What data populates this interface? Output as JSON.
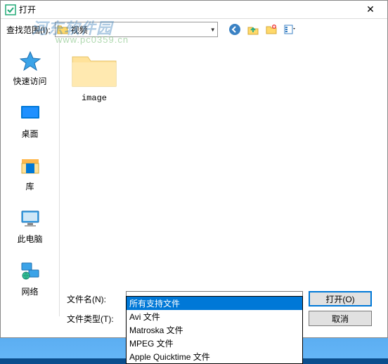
{
  "window": {
    "title": "打开"
  },
  "toolbar": {
    "lookin_label": "查找范围(I):",
    "location": "视频",
    "icons": [
      "back-icon",
      "up-icon",
      "new-folder-icon",
      "views-icon"
    ]
  },
  "sidebar": {
    "items": [
      {
        "label": "快速访问"
      },
      {
        "label": "桌面"
      },
      {
        "label": "库"
      },
      {
        "label": "此电脑"
      },
      {
        "label": "网络"
      }
    ]
  },
  "files": [
    {
      "name": "image",
      "type": "folder"
    }
  ],
  "bottom": {
    "filename_label": "文件名(N):",
    "filename_value": "",
    "filetype_label": "文件类型(T):",
    "filetype_value": "所有支持文件",
    "open_label": "打开(O)",
    "cancel_label": "取消"
  },
  "filetype_options": [
    "所有支持文件",
    "Avi 文件",
    "Matroska 文件",
    "MPEG 文件",
    "Apple Quicktime 文件"
  ],
  "watermark": {
    "main": "河东软件园",
    "sub": "www.pc0359.cn"
  }
}
